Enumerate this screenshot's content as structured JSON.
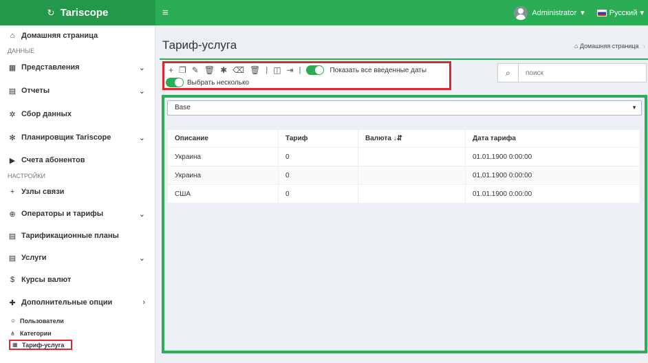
{
  "app": {
    "brand": "Tariscope",
    "brand_icon": "↻"
  },
  "topbar": {
    "user": "Administrator",
    "language": "Русский"
  },
  "sidebar": {
    "home": "Домашняя страница",
    "section_data": "ДАННЫЕ",
    "views": "Представления",
    "reports": "Отчеты",
    "data_collection": "Сбор данных",
    "scheduler": "Планировщик Tariscope",
    "subscriber_accounts": "Счета абонентов",
    "section_settings": "НАСТРОЙКИ",
    "nodes": "Узлы связи",
    "operators": "Операторы и тарифы",
    "billing_plans": "Тарификационные планы",
    "services": "Услуги",
    "currency_rates": "Курсы валют",
    "extra_options": "Дополнительные опции",
    "users": "Пользователи",
    "categories": "Категории",
    "tariff_service": "Тариф-услуга"
  },
  "page": {
    "title": "Тариф-услуга",
    "breadcrumb": "Домашняя страница"
  },
  "toolbar": {
    "show_dates": "Показать все введенные даты",
    "select_multiple": "Выбрать несколько"
  },
  "search": {
    "placeholder": "поиск"
  },
  "filter": {
    "selected": "Base"
  },
  "table": {
    "headers": [
      "Описание",
      "Тариф",
      "Валюта ↓⇵",
      "Дата тарифа"
    ],
    "rows": [
      [
        "Украина",
        "0",
        "",
        "01.01.1900 0:00:00"
      ],
      [
        "Украина",
        "0",
        "",
        "01.01.1900 0:00:00"
      ],
      [
        "США",
        "0",
        "",
        "01.01.1900 0:00:00"
      ]
    ]
  },
  "colors": {
    "brand_green": "#2aad55",
    "highlight_red": "#e0262e"
  }
}
